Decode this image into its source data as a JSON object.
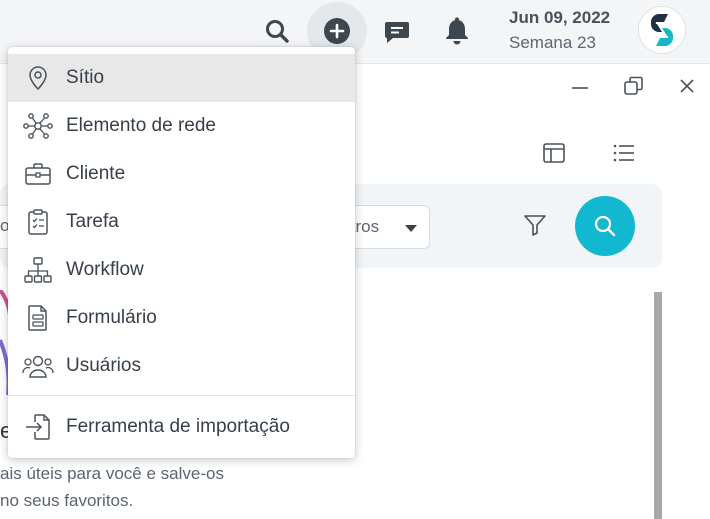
{
  "header": {
    "date": "Jun 09, 2022",
    "week": "Semana 23",
    "icons": [
      "search-icon",
      "add-circle-icon",
      "chat-icon",
      "bell-icon",
      "app-logo"
    ]
  },
  "colors": {
    "accent": "#12b8cf",
    "topbar": "#f3f5f7",
    "menu_active": "#e8e8e8",
    "logo_dark": "#1f2f44",
    "logo_teal": "#17b7c9"
  },
  "menu": {
    "items": [
      {
        "label": "Sítio",
        "icon": "location-pin-icon",
        "active": true
      },
      {
        "label": "Elemento de rede",
        "icon": "network-node-icon"
      },
      {
        "label": "Cliente",
        "icon": "briefcase-icon"
      },
      {
        "label": "Tarefa",
        "icon": "clipboard-checklist-icon"
      },
      {
        "label": "Workflow",
        "icon": "hierarchy-icon"
      },
      {
        "label": "Formulário",
        "icon": "document-form-icon"
      },
      {
        "label": "Usuários",
        "icon": "users-icon"
      },
      {
        "label": "Ferramenta de importação",
        "icon": "import-icon"
      }
    ]
  },
  "filters": {
    "left_input_fragment": "o",
    "select_fragment": "ltros"
  },
  "content": {
    "heading_fragment": "e",
    "description_line1": "ais úteis para você e salve-os",
    "description_line2": "no seus favoritos."
  }
}
